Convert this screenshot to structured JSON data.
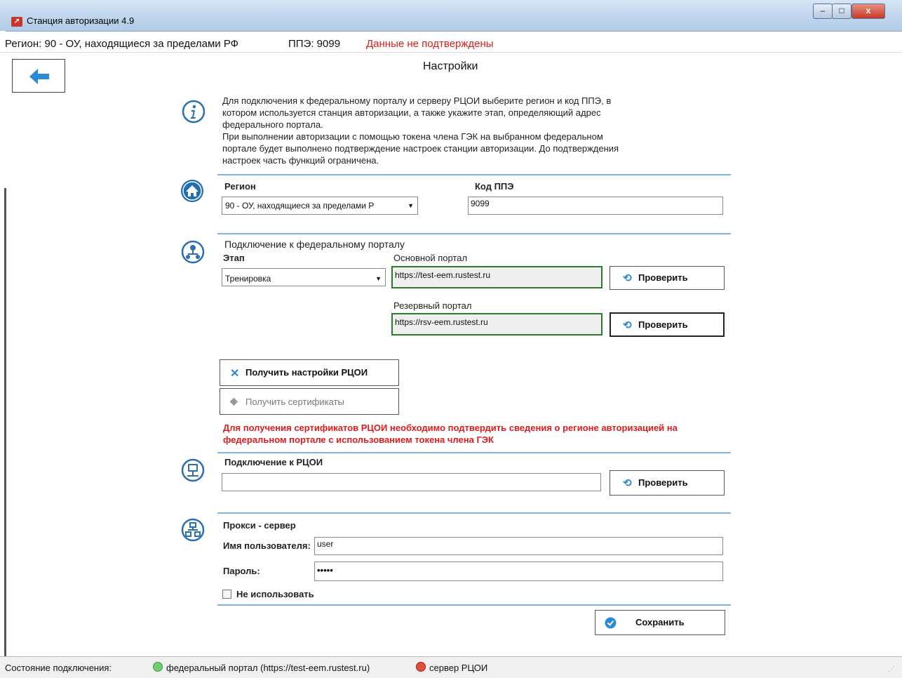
{
  "window": {
    "title": "Станция авторизации 4.9",
    "minimize": "–",
    "maximize": "□",
    "close": "x"
  },
  "region_bar": {
    "region": "Регион: 90 - ОУ, находящиеся за пределами РФ",
    "ppe": "ППЭ: 9099",
    "status": "Данные не подтверждены"
  },
  "page": {
    "title": "Настройки"
  },
  "info_text": [
    "Для подключения к федеральному порталу и серверу РЦОИ выберите регион и код ППЭ, в",
    "котором используется станция авторизации, а также укажите этап, определяющий адрес",
    "федерального портала.",
    "При выполнении авторизации с помощью токена члена ГЭК на выбранном федеральном",
    "портале будет выполнено подтверждение настроек станции авторизации. До подтверждения",
    "настроек часть функций ограничена."
  ],
  "region_section": {
    "region_label": "Регион",
    "region_value": "90 - ОУ, находящиеся за пределами Р",
    "ppe_label": "Код ППЭ",
    "ppe_value": "9099"
  },
  "portal_section": {
    "heading": "Подключение к федеральному порталу",
    "stage_label": "Этап",
    "stage_value": "Тренировка",
    "main_label": "Основной портал",
    "main_url": "https://test-eem.rustest.ru",
    "reserve_label": "Резервный портал",
    "reserve_url": "https://rsv-eem.rustest.ru",
    "check_label": "Проверить"
  },
  "rcoi_actions": {
    "get_settings": "Получить настройки РЦОИ",
    "get_certificates": "Получить сертификаты",
    "warning": "Для получения сертификатов РЦОИ необходимо подтвердить сведения о регионе авторизацией на федеральном портале с использованием токена члена ГЭК"
  },
  "rcoi_connection": {
    "heading": "Подключение к РЦОИ",
    "value": "",
    "check_label": "Проверить"
  },
  "proxy": {
    "heading": "Прокси - сервер",
    "user_label": "Имя пользователя:",
    "user_value": "user",
    "password_label": "Пароль:",
    "password_value": "•••••",
    "dont_use_label": "Не использовать",
    "dont_use_checked": false
  },
  "save_label": "Сохранить",
  "status_bar": {
    "label": "Состояние подключения:",
    "federal": "федеральный портал (https://test-eem.rustest.ru)",
    "federal_color": "#6fcf6f",
    "rcoi": "сервер РЦОИ",
    "rcoi_color": "#e0503c"
  },
  "colors": {
    "accent": "#2a8ad4",
    "warning": "#e01b1b",
    "separator": "#7eb3e0"
  }
}
